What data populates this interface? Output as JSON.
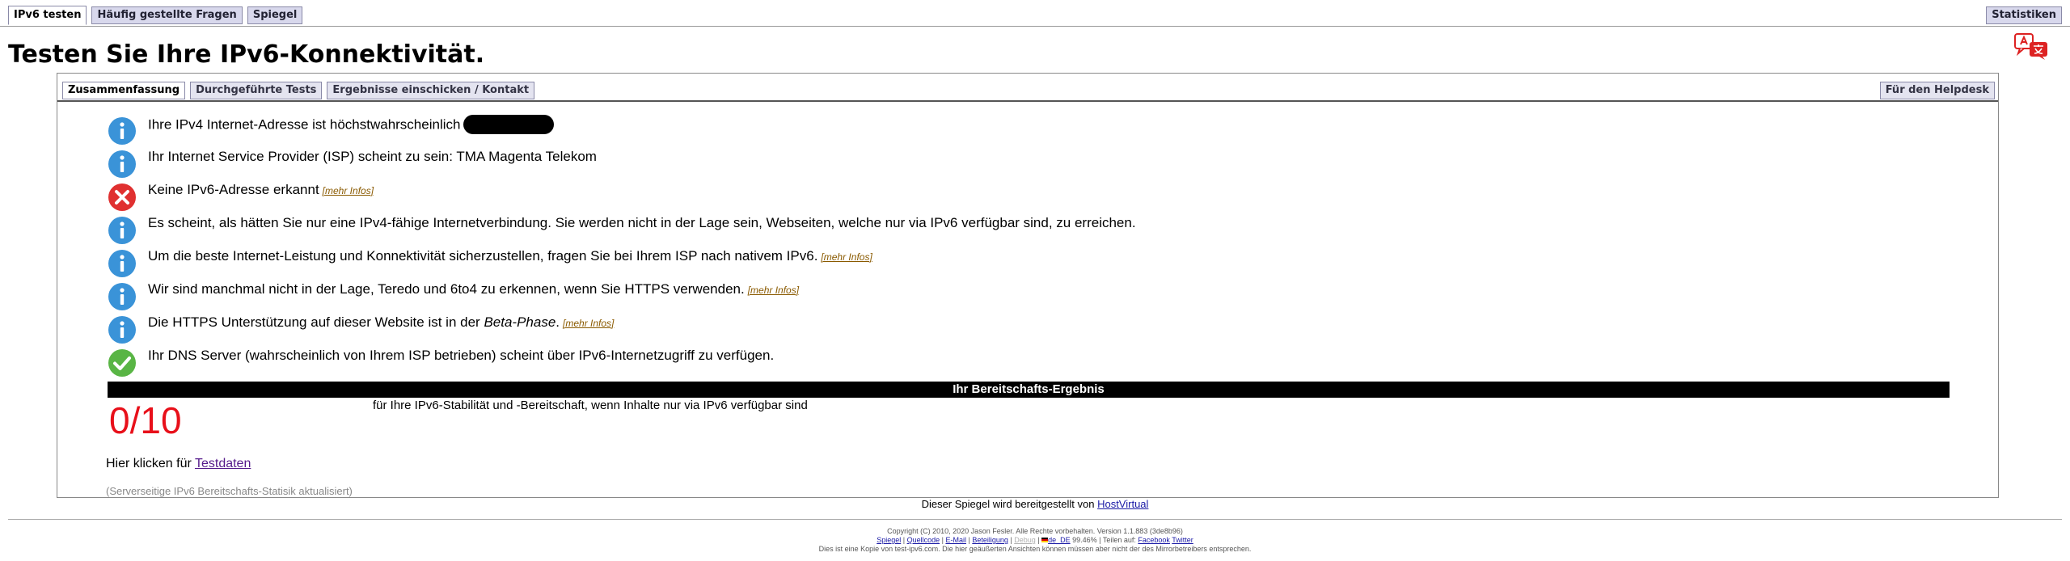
{
  "top_tabs": [
    "IPv6 testen",
    "Häufig gestellte Fragen",
    "Spiegel"
  ],
  "top_tab_right": "Statistiken",
  "page_title": "Testen Sie Ihre IPv6-Konnektivität.",
  "sub_tabs": [
    "Zusammenfassung",
    "Durchgeführte Tests",
    "Ergebnisse einschicken / Kontakt"
  ],
  "sub_tab_right": "Für den Helpdesk",
  "more_label": "[mehr Infos]",
  "rows": {
    "r0": "Ihre IPv4 Internet-Adresse ist höchstwahrscheinlich",
    "r1": "Ihr Internet Service Provider (ISP) scheint zu sein: TMA Magenta Telekom",
    "r2": "Keine IPv6-Adresse erkannt",
    "r3": "Es scheint, als hätten Sie nur eine IPv4-fähige Internetverbindung. Sie werden nicht in der Lage sein, Webseiten, welche nur via IPv6 verfügbar sind, zu erreichen.",
    "r4": "Um die beste Internet-Leistung und Konnektivität sicherzustellen, fragen Sie bei Ihrem ISP nach nativem IPv6.",
    "r5": "Wir sind manchmal nicht in der Lage, Teredo und 6to4 zu erkennen, wenn Sie HTTPS verwenden.",
    "r6a": "Die HTTPS Unterstützung auf dieser Website ist in der",
    "r6b": "Beta-Phase",
    "r6c": ".",
    "r7": "Ihr DNS Server (wahrscheinlich von Ihrem ISP betrieben) scheint über IPv6-Internetzugriff zu verfügen."
  },
  "score_header": "Ihr Bereitschafts-Ergebnis",
  "score_value": "0/10",
  "score_description": "für Ihre IPv6-Stabilität und -Bereitschaft, wenn Inhalte nur via IPv6 verfügbar sind",
  "testdata_prefix": "Hier klicken für",
  "testdata_link": "Testdaten",
  "server_note": "(Serverseitige IPv6 Bereitschafts-Statisik aktualisiert)",
  "mirror_text": "Dieser Spiegel wird bereitgestellt von",
  "mirror_link": "HostVirtual",
  "footer": {
    "copyright": "Copyright (C) 2010, 2020 Jason Fesler. Alle Rechte vorbehalten. Version 1.1.883 (3de8b96)",
    "links": [
      "Spiegel",
      "Quellcode",
      "E-Mail",
      "Beteiligung",
      "Debug"
    ],
    "locale": "de_DE",
    "percent": "99.46%",
    "share_label": "Teilen auf:",
    "share_links": [
      "Facebook",
      "Twitter"
    ],
    "disclaimer": "Dies ist eine Kopie von test-ipv6.com. Die hier geäußerten Ansichten können müssen aber nicht der des Mirrorbetreibers entsprechen."
  },
  "colors": {
    "info": "#3a93d8",
    "error": "#e03030",
    "ok": "#59b545",
    "score": "#e8101a",
    "tab_bg": "#d8d8ec"
  },
  "icons": [
    "info-icon",
    "error-icon",
    "check-icon",
    "translate-icon"
  ]
}
